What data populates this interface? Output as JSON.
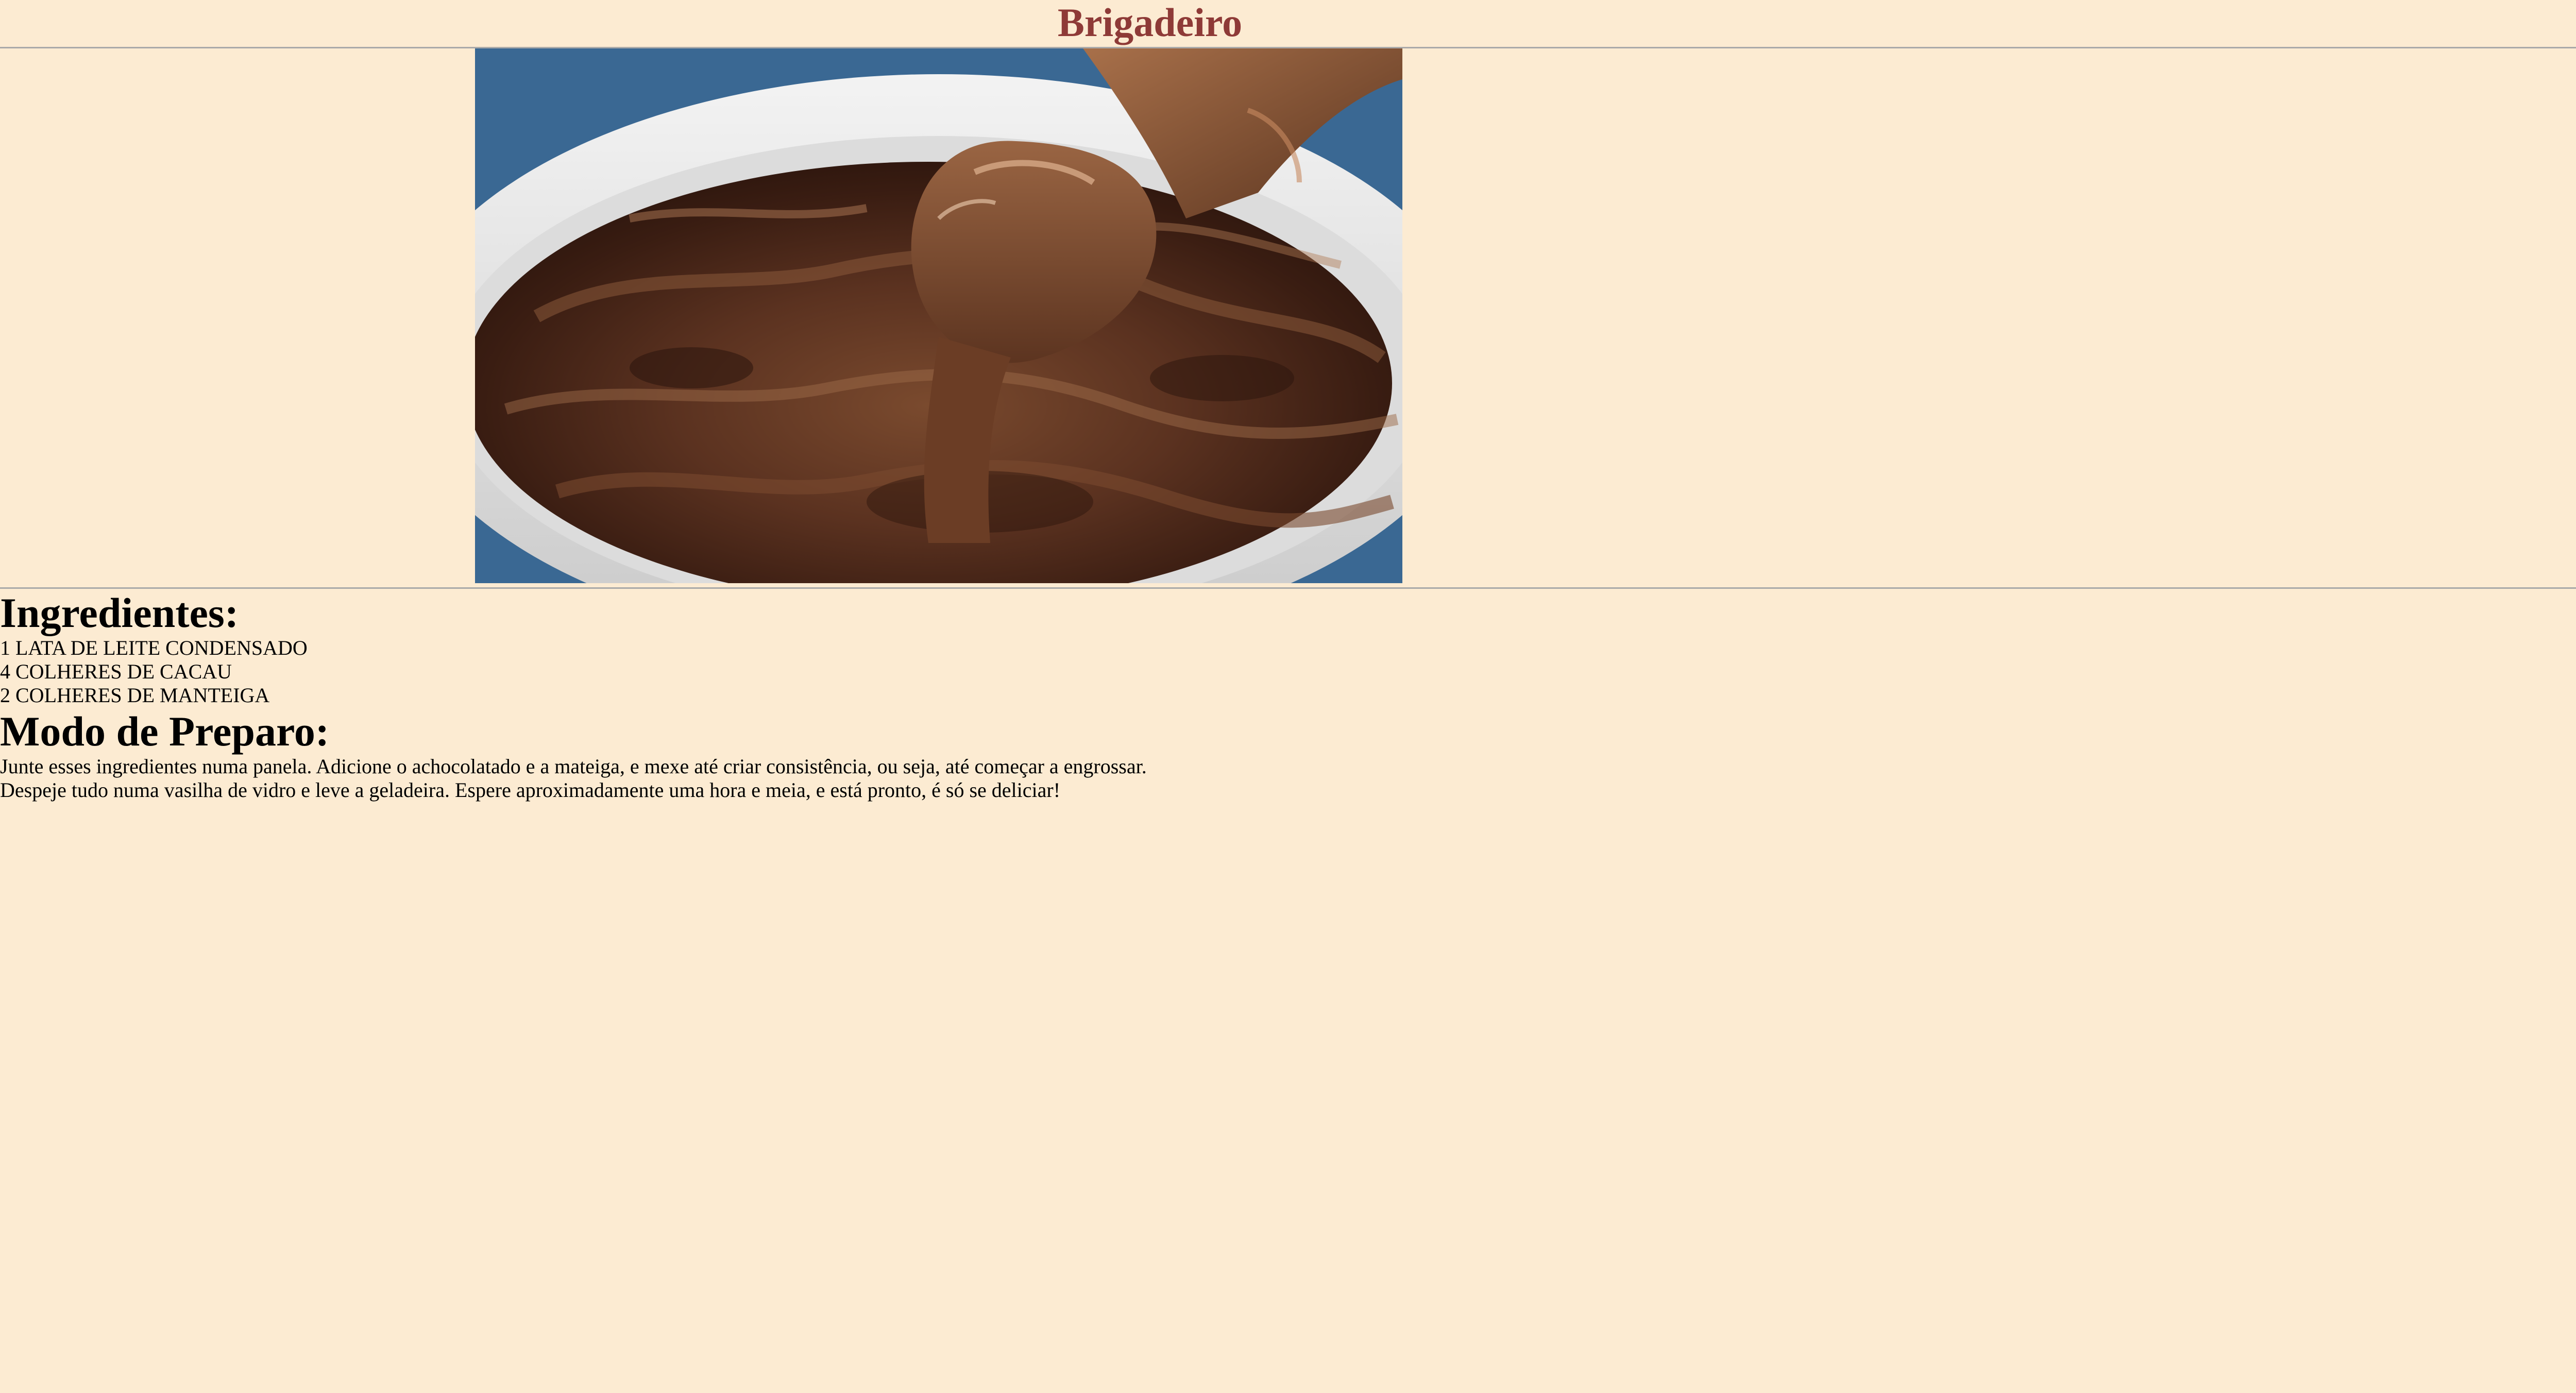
{
  "page": {
    "title": "Brigadeiro",
    "background_color": "#fcebd2",
    "title_color": "#8e3a37"
  },
  "image": {
    "alt": "Brigadeiro"
  },
  "ingredients": {
    "heading": "Ingredientes:",
    "items": [
      "1 LATA DE LEITE CONDENSADO",
      "4 COLHERES DE CACAU",
      "2 COLHERES DE MANTEIGA"
    ]
  },
  "preparation": {
    "heading": "Modo de Preparo:",
    "lines": [
      "Junte esses ingredientes numa panela. Adicione o achocolatado e a mateiga, e mexe até criar consistência, ou seja, até começar a engrossar.",
      "Despeje tudo numa vasilha de vidro e leve a geladeira. Espere aproximadamente uma hora e meia, e está pronto, é só se deliciar!"
    ]
  }
}
